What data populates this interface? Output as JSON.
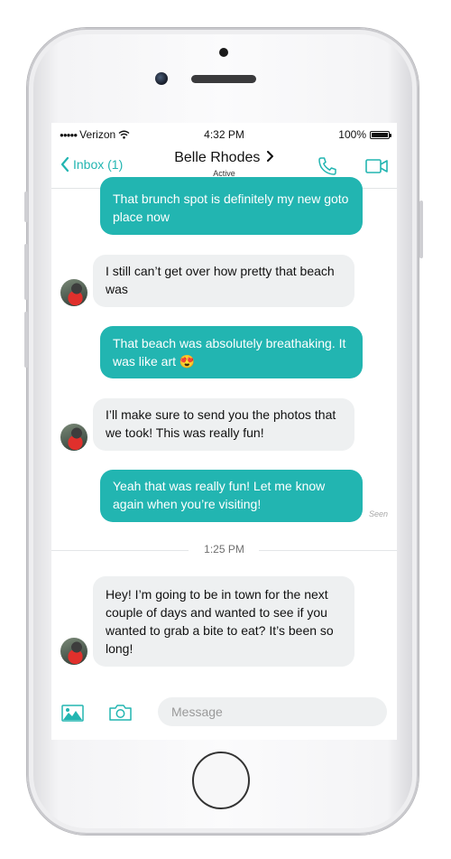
{
  "status_bar": {
    "signal_dots": "●●●●●",
    "carrier": "Verizon",
    "time": "4:32 PM",
    "battery": "100%"
  },
  "header": {
    "back_label": "Inbox (1)",
    "contact_name": "Belle Rhodes",
    "contact_status": "Active",
    "icons": [
      "back-chevron-icon",
      "contact-chevron-icon",
      "phone-icon",
      "video-camera-icon"
    ]
  },
  "messages": [
    {
      "direction": "outgoing",
      "text": "That brunch spot is definitely my new goto place now"
    },
    {
      "direction": "incoming",
      "text": "I still can’t get over how pretty that beach was"
    },
    {
      "direction": "outgoing",
      "text": "That beach was absolutely breathaking. It was like art 😍"
    },
    {
      "direction": "incoming",
      "text": "I’ll make sure to send you the photos that we took! This was really fun!"
    },
    {
      "direction": "outgoing",
      "text": "Yeah that was really fun! Let me know again when you’re visiting!"
    },
    {
      "direction": "incoming",
      "text": "Hey! I’m going to be in town for the next couple of days and wanted to see if you wanted to grab a bite to eat? It’s been so long!"
    }
  ],
  "seen_label": "Seen",
  "divider_time": "1:25 PM",
  "composer": {
    "placeholder": "Message",
    "icons": [
      "image-icon",
      "camera-icon"
    ]
  },
  "colors": {
    "accent": "#22b5b1",
    "incoming_bubble": "#eef0f1"
  }
}
